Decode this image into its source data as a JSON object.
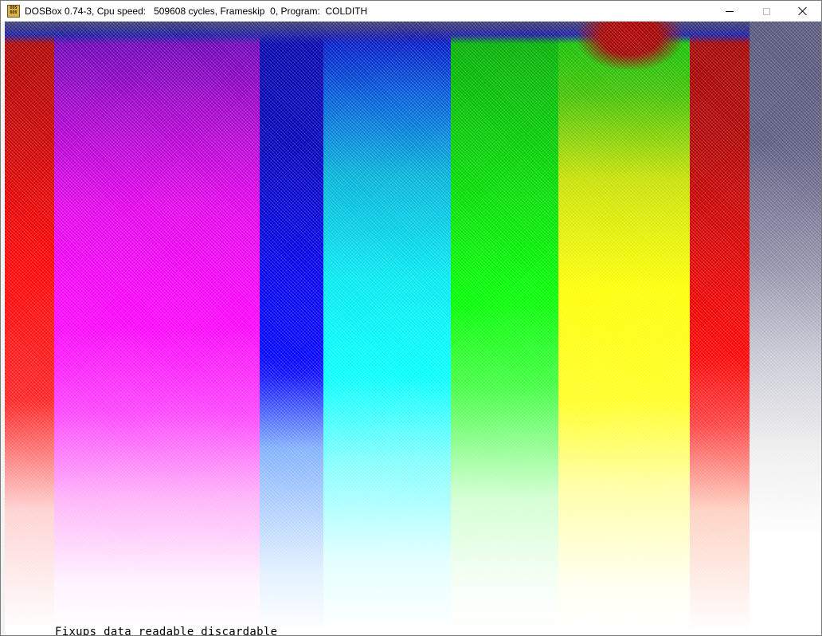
{
  "window": {
    "title": "DOSBox 0.74-3, Cpu speed:   509608 cycles, Frameskip  0, Program:  COLDITH",
    "app_icon_text": [
      "DOS",
      "BOX"
    ]
  },
  "screen": {
    "program": "COLDITH",
    "background_underneath_text": "Fixups data readable discardable"
  },
  "colors": {
    "red": "#ff0000",
    "magenta": "#ff00ff",
    "blue": "#0000ff",
    "cyan": "#00ffff",
    "green": "#00ff00",
    "yellow": "#ffff00",
    "grey": "#55557a",
    "white": "#ffffff"
  },
  "icons": {
    "app": "dosbox-icon",
    "minimize": "minimize-icon",
    "maximize": "maximize-icon",
    "close": "close-icon"
  }
}
